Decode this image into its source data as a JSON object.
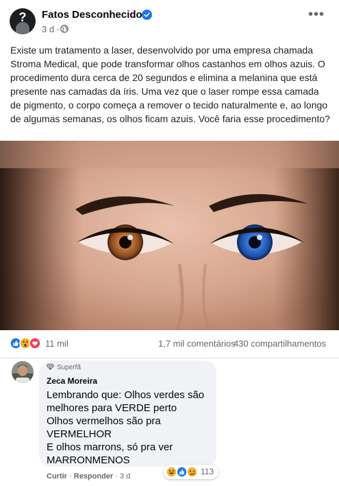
{
  "post": {
    "page_name": "Fatos Desconhecidos",
    "time": "3 d",
    "separator": "·",
    "more_label": "•••",
    "text": "Existe um tratamento a laser, desenvolvido por uma empresa chamada Stroma Medical, que pode transformar olhos castanhos em olhos azuis. O procedimento dura cerca de 20 segundos e elimina a melanina que está presente nas camadas da íris. Uma vez que o laser rompe essa camada de pigmento, o corpo começa a remover o tecido naturalmente e, ao longo de algumas semanas, os olhos ficam azuis. Você faria esse procedimento?"
  },
  "stats": {
    "reactions": "11 mil",
    "comments": "1,7 mil comentários",
    "shares": "430 compartilhamentos"
  },
  "comment": {
    "badge": "Superfã",
    "author": "Zeca Moreira",
    "lines": [
      "Lembrando que: Olhos verdes são",
      "melhores para VERDE perto",
      "Olhos vermelhos são pra",
      "VERMELHOR",
      "E olhos marrons, só pra ver",
      "MARRONMENOS"
    ],
    "reactions_count": "113",
    "actions": {
      "like": "Curtir",
      "dot": "·",
      "reply": "Responder",
      "time": "3 d"
    }
  },
  "colors": {
    "verified": "#1877f2",
    "like": "#1877f2",
    "love": "#f33e58",
    "haha": "#f7b125"
  }
}
